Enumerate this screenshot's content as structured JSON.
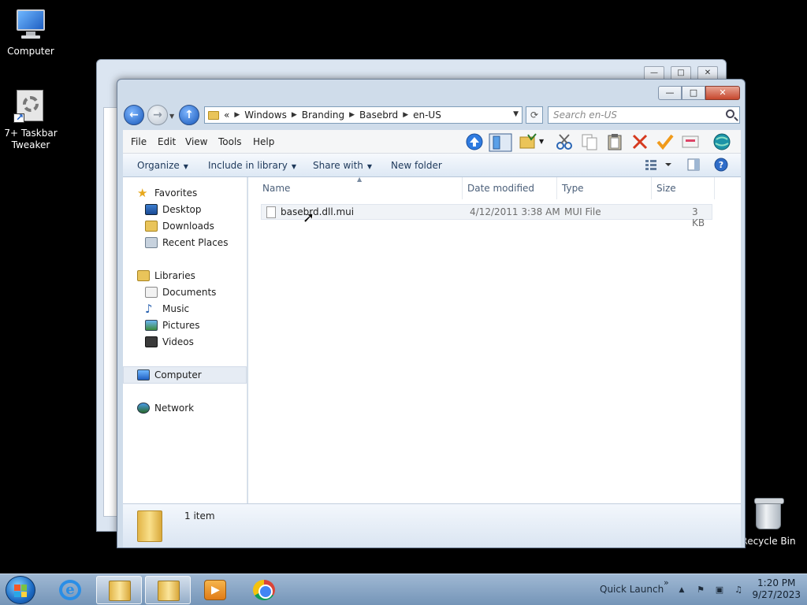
{
  "desktop": {
    "icons": [
      {
        "label": "Computer",
        "icon": "computer-icon"
      },
      {
        "label_line1": "7+ Taskbar",
        "label_line2": "Tweaker",
        "icon": "taskbar-tweaker-icon"
      },
      {
        "label": "Recycle Bin",
        "icon": "recycle-bin-icon"
      }
    ]
  },
  "window": {
    "controls": {
      "minimize": "—",
      "maximize": "□",
      "close": "✕"
    },
    "address": {
      "overflow": "«",
      "crumbs": [
        "Windows",
        "Branding",
        "Basebrd",
        "en-US"
      ]
    },
    "search": {
      "placeholder": "Search en-US"
    },
    "menu": [
      "File",
      "Edit",
      "View",
      "Tools",
      "Help"
    ],
    "command_bar": {
      "organize": "Organize",
      "include_in_library": "Include in library",
      "share_with": "Share with",
      "new_folder": "New folder"
    },
    "nav": {
      "favorites": "Favorites",
      "desktop": "Desktop",
      "downloads": "Downloads",
      "recent_places": "Recent Places",
      "libraries": "Libraries",
      "documents": "Documents",
      "music": "Music",
      "pictures": "Pictures",
      "videos": "Videos",
      "computer": "Computer",
      "network": "Network"
    },
    "columns": {
      "name": "Name",
      "date_modified": "Date modified",
      "type": "Type",
      "size": "Size"
    },
    "files": [
      {
        "name": "basebrd.dll.mui",
        "date_modified": "4/12/2011 3:38 AM",
        "type": "MUI File",
        "size": "3 KB"
      }
    ],
    "status": {
      "item_count": "1 item"
    }
  },
  "taskbar": {
    "quick_launch": "Quick Launch",
    "overflow": "»",
    "clock": {
      "time": "1:20 PM",
      "date": "9/27/2023"
    }
  }
}
